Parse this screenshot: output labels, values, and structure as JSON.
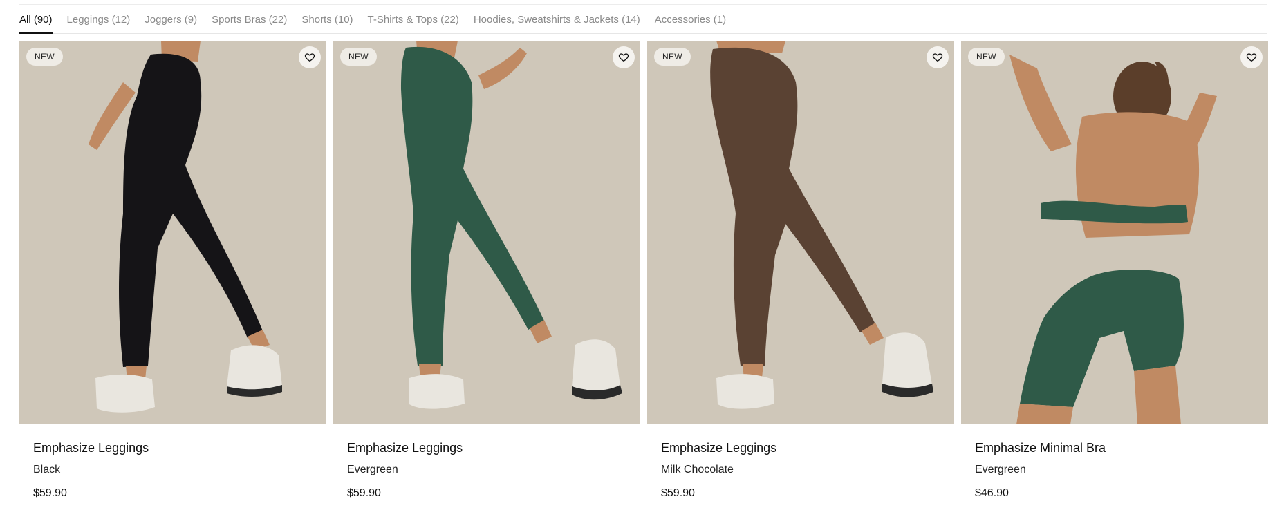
{
  "tabs": [
    {
      "label": "All (90)",
      "active": true
    },
    {
      "label": "Leggings (12)"
    },
    {
      "label": "Joggers (9)"
    },
    {
      "label": "Sports Bras (22)"
    },
    {
      "label": "Shorts (10)"
    },
    {
      "label": "T-Shirts & Tops (22)"
    },
    {
      "label": "Hoodies, Sweatshirts & Jackets (14)"
    },
    {
      "label": "Accessories (1)"
    }
  ],
  "products": [
    {
      "badge": "NEW",
      "name": "Emphasize Leggings",
      "variant": "Black",
      "price": "$59.90",
      "color": "#151417",
      "image": "leggings",
      "wishlist_icon": "heart-outline-icon"
    },
    {
      "badge": "NEW",
      "name": "Emphasize Leggings",
      "variant": "Evergreen",
      "price": "$59.90",
      "color": "#2f5a48",
      "image": "leggings",
      "wishlist_icon": "heart-outline-icon"
    },
    {
      "badge": "NEW",
      "name": "Emphasize Leggings",
      "variant": "Milk Chocolate",
      "price": "$59.90",
      "color": "#5a4233",
      "image": "leggings",
      "wishlist_icon": "heart-outline-icon"
    },
    {
      "badge": "NEW",
      "name": "Emphasize Minimal Bra",
      "variant": "Evergreen",
      "price": "$46.90",
      "color": "#2f5a48",
      "image": "bra-shorts",
      "wishlist_icon": "heart-outline-icon"
    }
  ],
  "colors": {
    "photo_background": "#cfc7b9",
    "skin": "#c08a63",
    "sneaker": "#e9e6df"
  }
}
